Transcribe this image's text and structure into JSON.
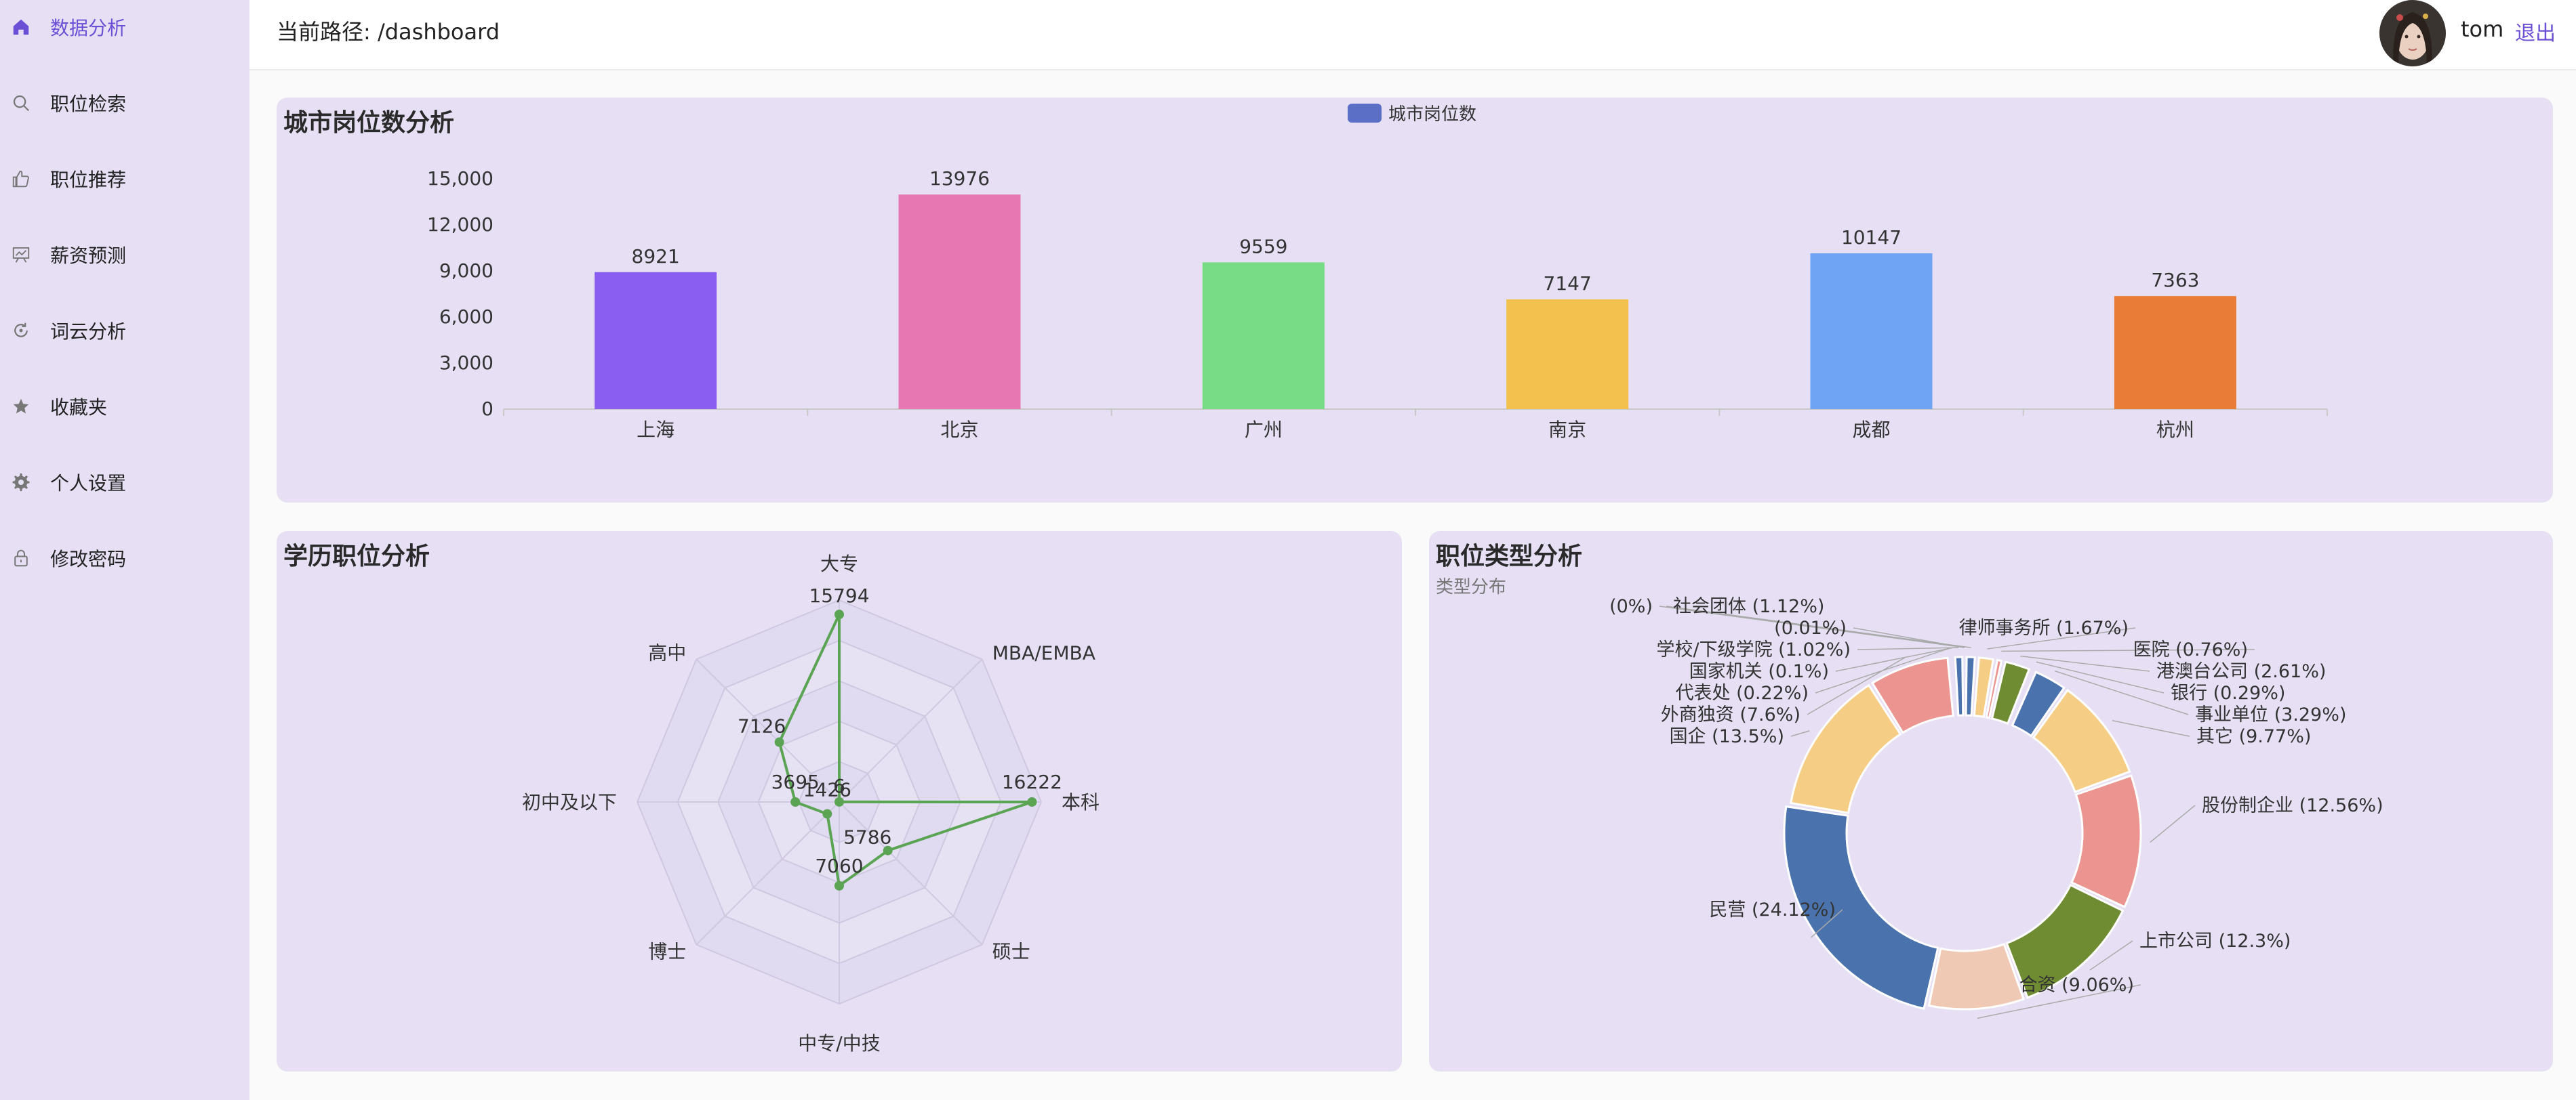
{
  "sidebar": {
    "items": [
      {
        "label": "数据分析",
        "icon": "home-icon",
        "active": true
      },
      {
        "label": "职位检索",
        "icon": "search-icon",
        "active": false
      },
      {
        "label": "职位推荐",
        "icon": "thumb-up-icon",
        "active": false
      },
      {
        "label": "薪资预测",
        "icon": "presentation-icon",
        "active": false
      },
      {
        "label": "词云分析",
        "icon": "cloud-refresh-icon",
        "active": false
      },
      {
        "label": "收藏夹",
        "icon": "star-icon",
        "active": false
      },
      {
        "label": "个人设置",
        "icon": "gear-icon",
        "active": false
      },
      {
        "label": "修改密码",
        "icon": "lock-icon",
        "active": false
      }
    ]
  },
  "header": {
    "path_text": "当前路径: /dashboard",
    "username": "tom",
    "logout_label": "退出"
  },
  "colors": {
    "accent": "#6b4fd4",
    "card_bg": "#e7e0f5",
    "radar_line": "#5aa454"
  },
  "charts": {
    "city": {
      "title": "城市岗位数分析"
    },
    "edu": {
      "title": "学历职位分析"
    },
    "jobtype": {
      "title": "职位类型分析",
      "subtitle": "类型分布"
    }
  },
  "chart_data": [
    {
      "type": "bar",
      "title": "城市岗位数分析",
      "legend": [
        "城市岗位数"
      ],
      "legend_position": "top-center",
      "categories": [
        "上海",
        "北京",
        "广州",
        "南京",
        "成都",
        "杭州"
      ],
      "values": [
        8921,
        13976,
        9559,
        7147,
        10147,
        7363
      ],
      "colors": [
        "#8a5ef0",
        "#e777b3",
        "#78dc87",
        "#f2c14e",
        "#6fa3f4",
        "#e97c36"
      ],
      "yticks": [
        "0",
        "3,000",
        "6,000",
        "9,000",
        "12,000",
        "15,000"
      ],
      "ylim": [
        0,
        15000
      ]
    },
    {
      "type": "radar",
      "title": "学历职位分析",
      "indicators": [
        "大专",
        "MBA/EMBA",
        "本科",
        "硕士",
        "中专/中技",
        "博士",
        "初中及以下",
        "高中"
      ],
      "values": [
        15794,
        6,
        16222,
        5786,
        7060,
        1426,
        3695,
        7126
      ],
      "max": 17000
    },
    {
      "type": "pie",
      "title": "职位类型分析",
      "subtitle": "类型分布",
      "style": "donut",
      "slices": [
        {
          "name": "",
          "value": 0,
          "label": "(0%)",
          "color": "#4a72ad"
        },
        {
          "name": "社会团体",
          "value": 1.12,
          "label": "社会团体 (1.12%)",
          "color": "#4a72ad"
        },
        {
          "name": "律师事务所",
          "value": 1.67,
          "label": "律师事务所 (1.67%)",
          "color": "#f5cd85"
        },
        {
          "name": "医院",
          "value": 0.76,
          "label": "医院 (0.76%)",
          "color": "#ec9590"
        },
        {
          "name": "港澳台公司",
          "value": 2.61,
          "label": "港澳台公司 (2.61%)",
          "color": "#6f8c33"
        },
        {
          "name": "银行",
          "value": 0.29,
          "label": "银行 (0.29%)",
          "color": "#f0c9b5"
        },
        {
          "name": "事业单位",
          "value": 3.29,
          "label": "事业单位 (3.29%)",
          "color": "#4a72ad"
        },
        {
          "name": "其它",
          "value": 9.77,
          "label": "其它 (9.77%)",
          "color": "#f5cd85"
        },
        {
          "name": "股份制企业",
          "value": 12.56,
          "label": "股份制企业 (12.56%)",
          "color": "#ec9590"
        },
        {
          "name": "上市公司",
          "value": 12.3,
          "label": "上市公司 (12.3%)",
          "color": "#6f8c33"
        },
        {
          "name": "合资",
          "value": 9.06,
          "label": "合资 (9.06%)",
          "color": "#f0c9b5"
        },
        {
          "name": "民营",
          "value": 24.12,
          "label": "民营 (24.12%)",
          "color": "#4a72ad"
        },
        {
          "name": "国企",
          "value": 13.5,
          "label": "国企 (13.5%)",
          "color": "#f5cd85"
        },
        {
          "name": "外商独资",
          "value": 7.6,
          "label": "外商独资 (7.6%)",
          "color": "#ec9590"
        },
        {
          "name": "代表处",
          "value": 0.22,
          "label": "代表处 (0.22%)",
          "color": "#6f8c33"
        },
        {
          "name": "国家机关",
          "value": 0.1,
          "label": "国家机关 (0.1%)",
          "color": "#f0c9b5"
        },
        {
          "name": "学校/下级学院",
          "value": 1.02,
          "label": "学校/下级学院 (1.02%)",
          "color": "#4a72ad"
        },
        {
          "name": "",
          "value": 0.01,
          "label": "(0.01%)",
          "color": "#f5cd85"
        }
      ]
    }
  ]
}
